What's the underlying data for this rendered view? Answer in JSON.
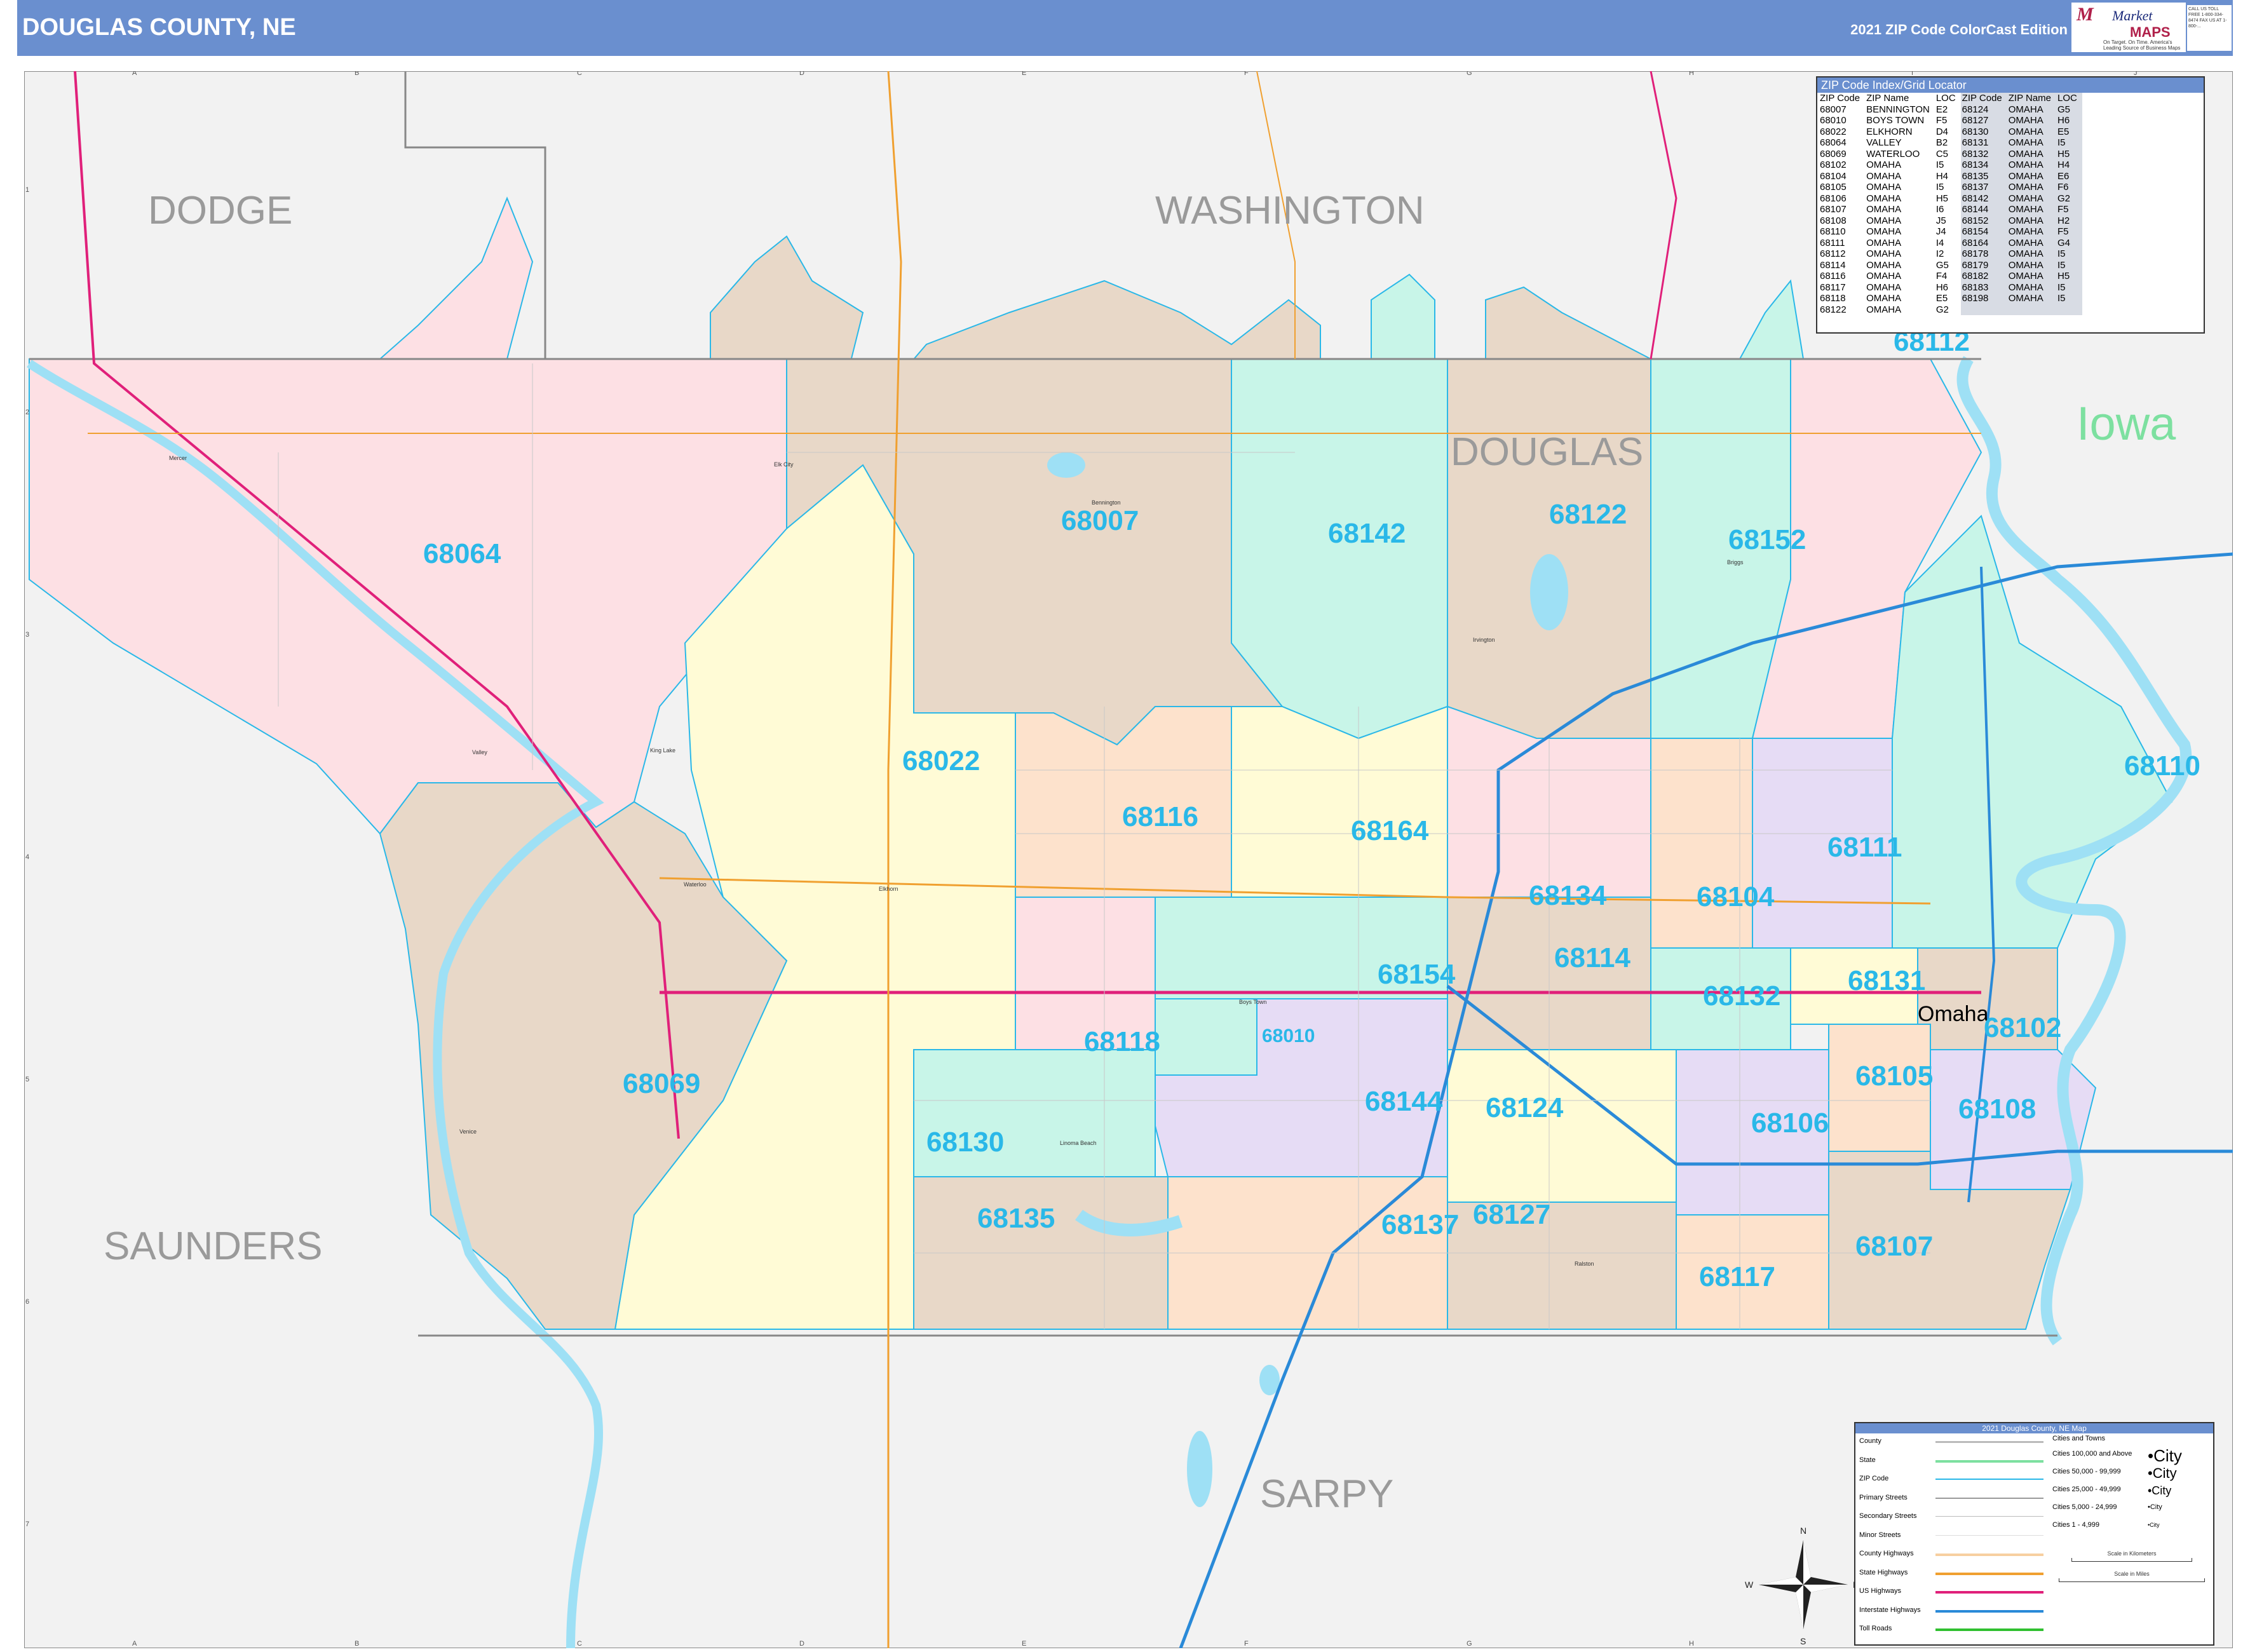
{
  "header": {
    "title": "DOUGLAS COUNTY, NE",
    "edition": "2021 ZIP Code ColorCast Edition",
    "logo": {
      "word1": "Market",
      "word2": "MAPS",
      "tagline": "On Target. On Time. America's Leading Source of Business Maps"
    },
    "contact": "CALL US TOLL FREE 1-800-334-8474 FAX US AT 1-800-..."
  },
  "map": {
    "county_labels": [
      "DODGE",
      "WASHINGTON",
      "DOUGLAS",
      "SAUNDERS",
      "SARPY"
    ],
    "state_label": "Iowa",
    "city_label": "Omaha",
    "towns": [
      "Mercer",
      "Elk City",
      "Bennington",
      "Valley",
      "King Lake",
      "Waterloo",
      "Elkhorn",
      "Boys Town",
      "Venice",
      "Irvington",
      "Briggs",
      "Ralston",
      "Linoma Beach"
    ],
    "zip_labels": [
      "68064",
      "68007",
      "68142",
      "68122",
      "68152",
      "68112",
      "68022",
      "68116",
      "68164",
      "68110",
      "68111",
      "68134",
      "68104",
      "68154",
      "68114",
      "68131",
      "68069",
      "68118",
      "68010",
      "68132",
      "68102",
      "68144",
      "68124",
      "68105",
      "68108",
      "68130",
      "68106",
      "68135",
      "68137",
      "68127",
      "68107",
      "68117"
    ],
    "grid_columns": [
      "A",
      "B",
      "C",
      "D",
      "E",
      "F",
      "G",
      "H",
      "I",
      "J"
    ],
    "grid_rows": [
      "1",
      "2",
      "3",
      "4",
      "5",
      "6",
      "7"
    ],
    "compass": [
      "N",
      "S",
      "E",
      "W"
    ],
    "colors": {
      "pink": "#fde0e4",
      "tan": "#e8d8c8",
      "mint": "#c8f5e8",
      "yellow": "#fffbd6",
      "lavender": "#e6dcf5",
      "peach": "#fde2cc",
      "land": "#f2f2f2",
      "water": "#9ee0f5",
      "zip_text": "#2ab8e8",
      "header": "#6a8fcf"
    }
  },
  "zip_index": {
    "title": "ZIP Code Index/Grid Locator",
    "columns": [
      "ZIP Code",
      "ZIP Name",
      "LOC",
      "ZIP Code",
      "ZIP Name",
      "LOC"
    ],
    "rows": [
      [
        "68007",
        "BENNINGTON",
        "E2",
        "68124",
        "OMAHA",
        "G5"
      ],
      [
        "68010",
        "BOYS TOWN",
        "F5",
        "68127",
        "OMAHA",
        "H6"
      ],
      [
        "68022",
        "ELKHORN",
        "D4",
        "68130",
        "OMAHA",
        "E5"
      ],
      [
        "68064",
        "VALLEY",
        "B2",
        "68131",
        "OMAHA",
        "I5"
      ],
      [
        "68069",
        "WATERLOO",
        "C5",
        "68132",
        "OMAHA",
        "H5"
      ],
      [
        "68102",
        "OMAHA",
        "I5",
        "68134",
        "OMAHA",
        "H4"
      ],
      [
        "68104",
        "OMAHA",
        "H4",
        "68135",
        "OMAHA",
        "E6"
      ],
      [
        "68105",
        "OMAHA",
        "I5",
        "68137",
        "OMAHA",
        "F6"
      ],
      [
        "68106",
        "OMAHA",
        "H5",
        "68142",
        "OMAHA",
        "G2"
      ],
      [
        "68107",
        "OMAHA",
        "I6",
        "68144",
        "OMAHA",
        "F5"
      ],
      [
        "68108",
        "OMAHA",
        "J5",
        "68152",
        "OMAHA",
        "H2"
      ],
      [
        "68110",
        "OMAHA",
        "J4",
        "68154",
        "OMAHA",
        "F5"
      ],
      [
        "68111",
        "OMAHA",
        "I4",
        "68164",
        "OMAHA",
        "G4"
      ],
      [
        "68112",
        "OMAHA",
        "I2",
        "68178",
        "OMAHA",
        "I5"
      ],
      [
        "68114",
        "OMAHA",
        "G5",
        "68179",
        "OMAHA",
        "I5"
      ],
      [
        "68116",
        "OMAHA",
        "F4",
        "68182",
        "OMAHA",
        "H5"
      ],
      [
        "68117",
        "OMAHA",
        "H6",
        "68183",
        "OMAHA",
        "I5"
      ],
      [
        "68118",
        "OMAHA",
        "E5",
        "68198",
        "OMAHA",
        "I5"
      ],
      [
        "68122",
        "OMAHA",
        "G2",
        "",
        "",
        ""
      ]
    ]
  },
  "legend": {
    "title": "2021 Douglas County, NE Map",
    "items": [
      "County",
      "State",
      "ZIP Code",
      "Primary Streets",
      "Secondary Streets",
      "Minor Streets",
      "County Highways",
      "State Highways",
      "US Highways",
      "Interstate Highways",
      "Toll Roads"
    ],
    "city_header": "Cities and Towns",
    "city_classes": [
      {
        "label": "Cities 100,000 and Above",
        "sample": "•City"
      },
      {
        "label": "Cities 50,000 - 99,999",
        "sample": "•City"
      },
      {
        "label": "Cities 25,000 - 49,999",
        "sample": "•City"
      },
      {
        "label": "Cities 5,000 - 24,999",
        "sample": "•City"
      },
      {
        "label": "Cities 1 - 4,999",
        "sample": "•City"
      }
    ],
    "scale_km": "Scale in Kilometers",
    "scale_mi": "Scale in Miles"
  }
}
